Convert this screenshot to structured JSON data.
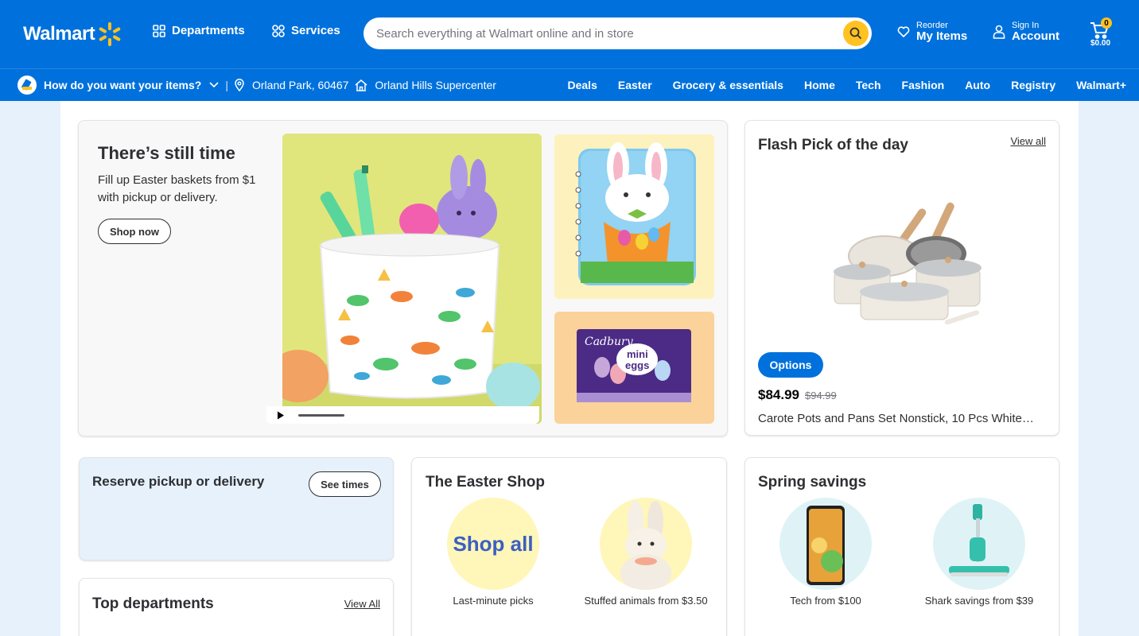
{
  "header": {
    "logo_text": "Walmart",
    "departments_label": "Departments",
    "services_label": "Services",
    "search_placeholder": "Search everything at Walmart online and in store",
    "reorder_small": "Reorder",
    "reorder_large": "My Items",
    "signin_small": "Sign In",
    "signin_large": "Account",
    "cart_count": "0",
    "cart_total": "$0.00",
    "brand_color": "#0071dc",
    "accent_color": "#ffc220"
  },
  "subnav": {
    "question": "How do you want your items?",
    "location": "Orland Park, 60467",
    "store": "Orland Hills Supercenter",
    "categories": [
      "Deals",
      "Easter",
      "Grocery & essentials",
      "Home",
      "Tech",
      "Fashion",
      "Auto",
      "Registry",
      "Walmart+"
    ]
  },
  "hero": {
    "title": "There’s still time",
    "subtitle": "Fill up Easter baskets from $1 with pickup or delivery.",
    "cta": "Shop now",
    "candy_brand": "Cadbury",
    "candy_name_1": "mini",
    "candy_name_2": "eggs"
  },
  "flash": {
    "title": "Flash Pick of the day",
    "view_all": "View all",
    "options_label": "Options",
    "price": "$84.99",
    "was_price": "$94.99",
    "product_name": "Carote Pots and Pans Set Nonstick, 10 Pcs White…"
  },
  "reserve": {
    "title": "Reserve pickup or delivery",
    "cta": "See times"
  },
  "top_departments": {
    "title": "Top departments",
    "view_all": "View All"
  },
  "easter_shop": {
    "title": "The Easter Shop",
    "shop_all_text": "Shop all",
    "items": [
      {
        "caption": "Last-minute picks"
      },
      {
        "caption": "Stuffed animals from $3.50"
      }
    ]
  },
  "spring": {
    "title": "Spring savings",
    "items": [
      {
        "caption": "Tech from $100"
      },
      {
        "caption": "Shark savings from $39"
      }
    ]
  }
}
